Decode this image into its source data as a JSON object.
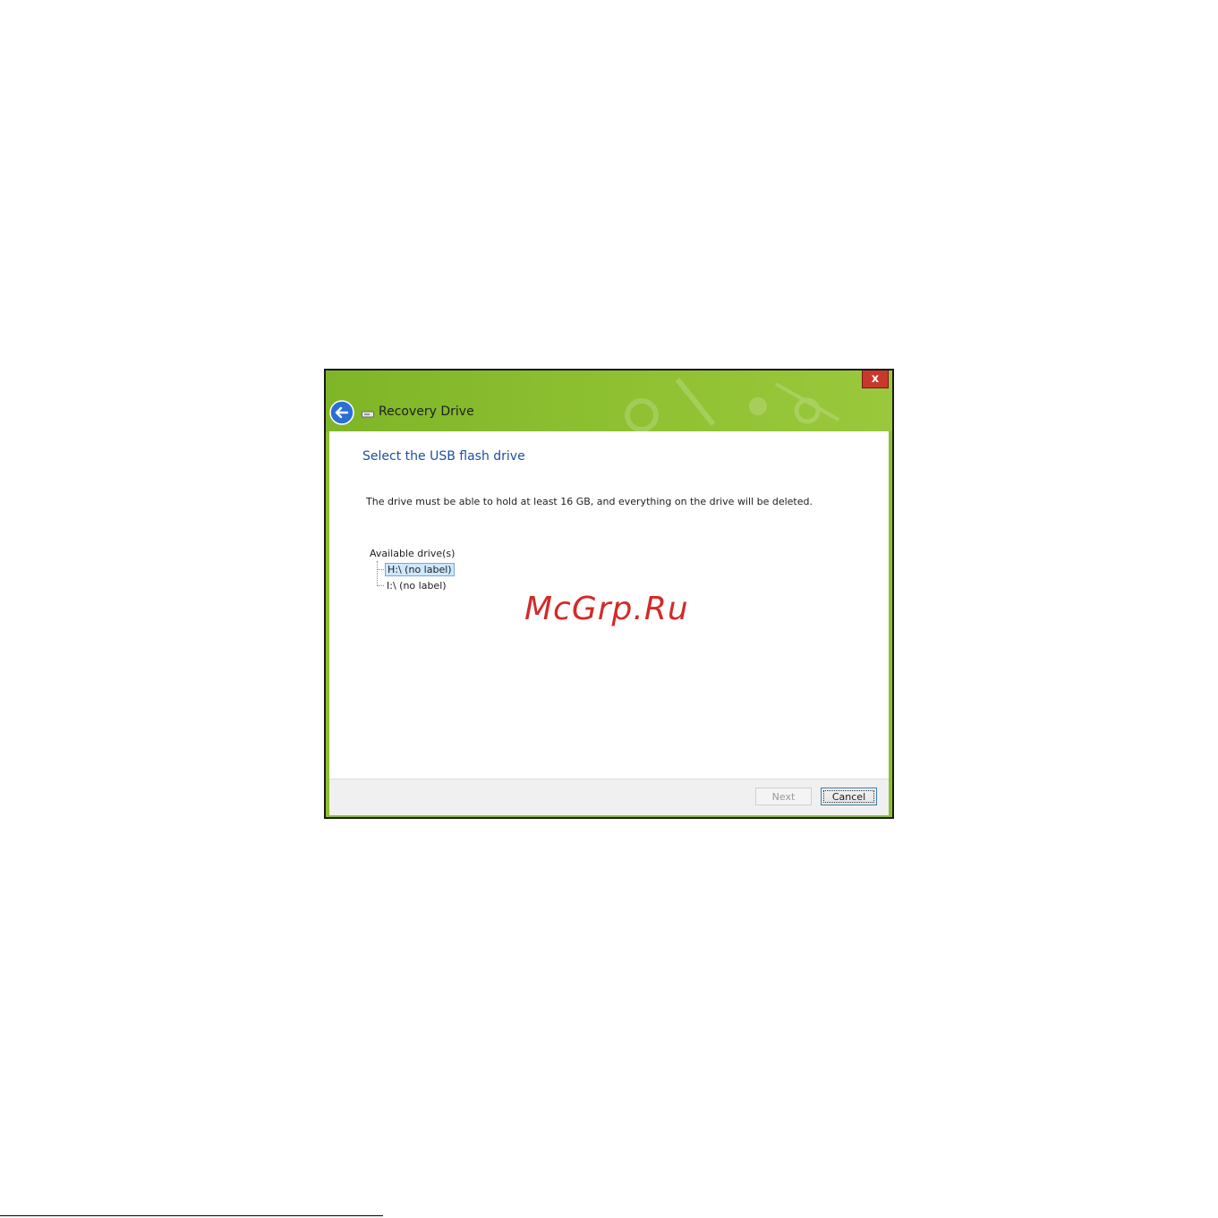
{
  "window": {
    "title": "Recovery Drive",
    "close_label": "x",
    "accent_color": "#8cbf2e"
  },
  "main": {
    "heading": "Select the USB flash drive",
    "description": "The drive must be able to hold at least 16 GB, and everything on the drive will be deleted.",
    "drives_label": "Available drive(s)",
    "drives": [
      {
        "label": "H:\\ (no label)",
        "selected": true
      },
      {
        "label": "I:\\ (no label)",
        "selected": false
      }
    ]
  },
  "footer": {
    "next_label": "Next",
    "cancel_label": "Cancel"
  },
  "watermark": "McGrp.Ru"
}
